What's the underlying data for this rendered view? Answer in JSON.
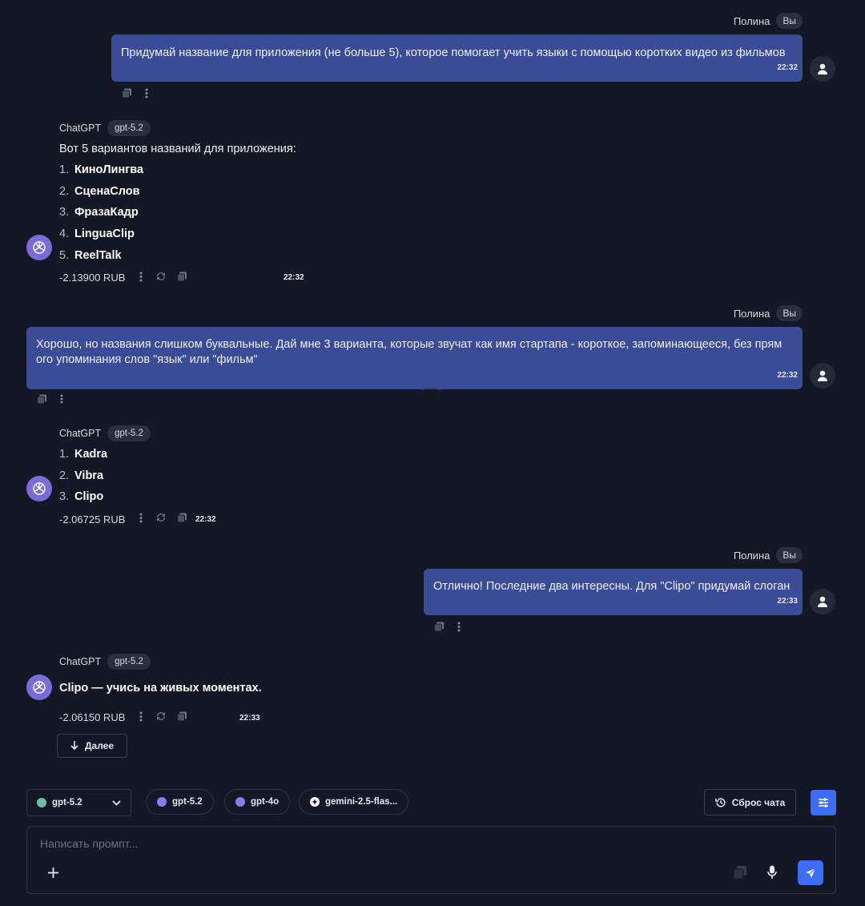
{
  "messages": {
    "m1": {
      "author": "Полина",
      "badge": "Вы",
      "text": "Придумай название для приложения (не больше 5), которое помогает учить языки с помощью коротких видео из фильмов",
      "time": "22:32"
    },
    "r1": {
      "author": "ChatGPT",
      "model": "gpt-5.2",
      "intro": "Вот 5 вариантов названий для приложения:",
      "items": [
        "КиноЛингва",
        "СценаСлов",
        "ФразаКадр",
        "LinguaClip",
        "ReelTalk"
      ],
      "cost": "-2.13900 RUB",
      "time": "22:32"
    },
    "m2": {
      "author": "Полина",
      "badge": "Вы",
      "text_line1": "Хорошо, но названия слишком буквальные. Дай мне 3 варианта, которые звучат как имя стартапа - короткое, запоминающееся, без прям",
      "text_line2": "ого упоминания слов \"язык\" или \"фильм\"",
      "time": "22:32"
    },
    "r2": {
      "author": "ChatGPT",
      "model": "gpt-5.2",
      "items": [
        "Kadra",
        "Vibra",
        "Clipo"
      ],
      "cost": "-2.06725 RUB",
      "time": "22:32"
    },
    "m3": {
      "author": "Полина",
      "badge": "Вы",
      "text": "Отлично! Последние два интересны. Для \"Clipo\" придумай слоган",
      "time": "22:33"
    },
    "r3": {
      "author": "ChatGPT",
      "model": "gpt-5.2",
      "text": "Clipo — учись на живых моментах.",
      "cost": "-2.06150 RUB",
      "time": "22:33"
    }
  },
  "next_button": {
    "label": "Далее"
  },
  "toolbar": {
    "model_select": "gpt-5.2",
    "chips": [
      {
        "label": "gpt-5.2",
        "color": "#8b7cf0"
      },
      {
        "label": "gpt-4o",
        "color": "#8b7cf0"
      },
      {
        "label": "gemini-2.5-flas...",
        "color": "#ffffff"
      }
    ],
    "reset_label": "Сброс чата"
  },
  "composer": {
    "placeholder": "Написать промпт..."
  },
  "colors": {
    "background": "#141724",
    "user_bubble": "#3a4c95",
    "accent": "#3b6ef5",
    "gpt_avatar": "#7a6bd9"
  },
  "icons": [
    "user-icon",
    "openai-icon",
    "copy-icon",
    "more-icon",
    "regenerate-icon",
    "arrow-down-icon",
    "chevron-down-icon",
    "history-icon",
    "sliders-icon",
    "plus-icon",
    "mic-icon",
    "send-icon"
  ]
}
